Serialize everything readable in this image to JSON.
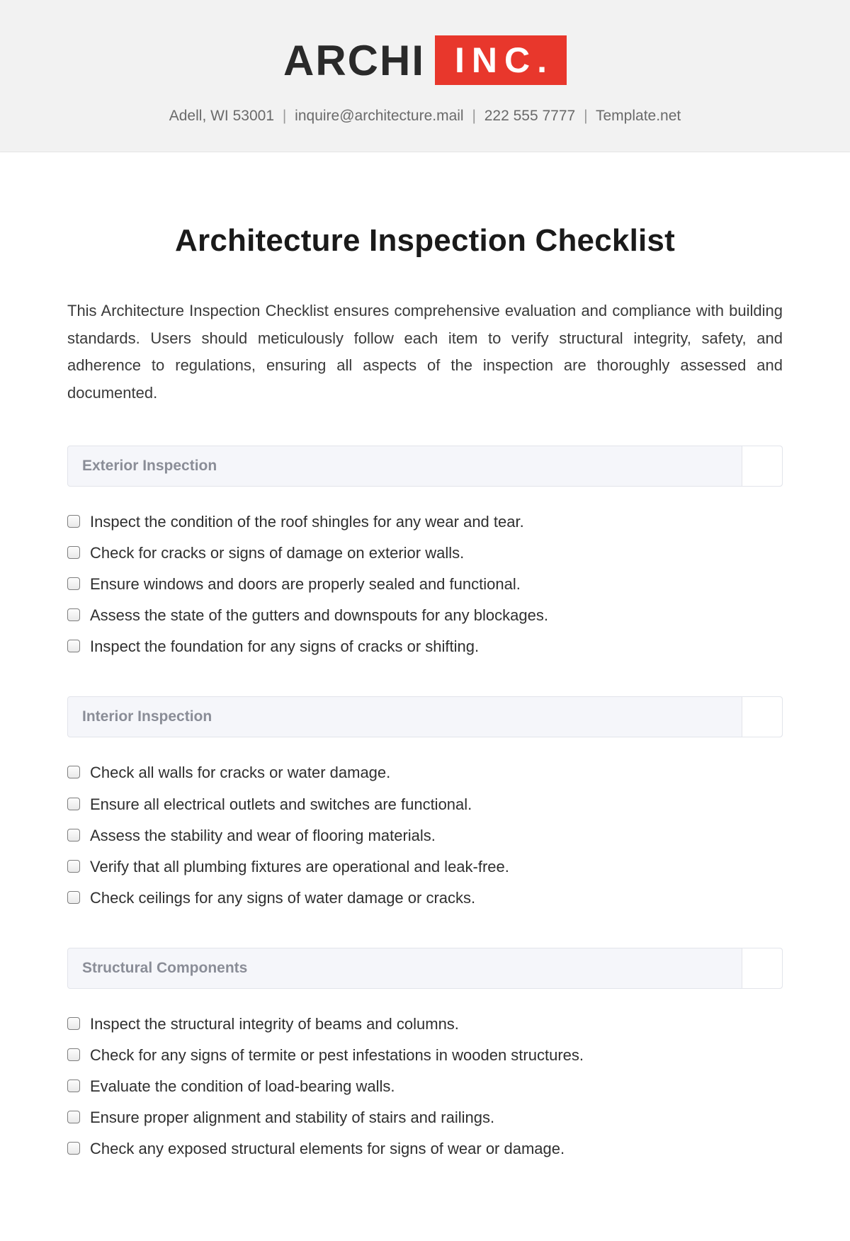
{
  "header": {
    "logo_text": "ARCHI",
    "logo_badge": "INC.",
    "address": "Adell, WI 53001",
    "email": "inquire@architecture.mail",
    "phone": "222 555 7777",
    "site": "Template.net"
  },
  "title": "Architecture Inspection Checklist",
  "intro": "This Architecture Inspection Checklist ensures comprehensive evaluation and compliance with building standards. Users should meticulously follow each item to verify structural integrity, safety, and adherence to regulations, ensuring all aspects of the inspection are thoroughly assessed and documented.",
  "sections": [
    {
      "title": "Exterior Inspection",
      "items": [
        "Inspect the condition of the roof shingles for any wear and tear.",
        "Check for cracks or signs of damage on exterior walls.",
        "Ensure windows and doors are properly sealed and functional.",
        "Assess the state of the gutters and downspouts for any blockages.",
        "Inspect the foundation for any signs of cracks or shifting."
      ]
    },
    {
      "title": "Interior Inspection",
      "items": [
        "Check all walls for cracks or water damage.",
        "Ensure all electrical outlets and switches are functional.",
        "Assess the stability and wear of flooring materials.",
        "Verify that all plumbing fixtures are operational and leak-free.",
        "Check ceilings for any signs of water damage or cracks."
      ]
    },
    {
      "title": "Structural Components",
      "items": [
        "Inspect the structural integrity of beams and columns.",
        "Check for any signs of termite or pest infestations in wooden structures.",
        "Evaluate the condition of load-bearing walls.",
        "Ensure proper alignment and stability of stairs and railings.",
        "Check any exposed structural elements for signs of wear or damage."
      ]
    }
  ]
}
